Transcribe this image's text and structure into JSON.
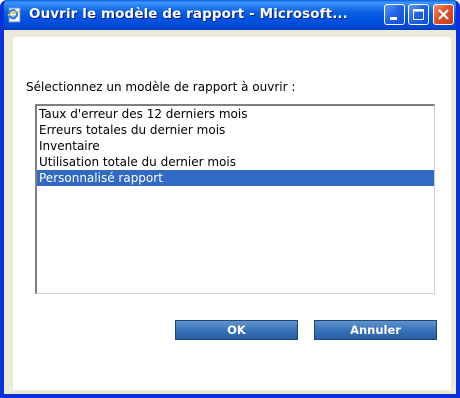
{
  "window": {
    "title": "Ouvrir le modèle de rapport - Microsoft...",
    "app_icon": "ie-document-icon",
    "controls": [
      "minimize-icon",
      "maximize-icon",
      "close-icon"
    ]
  },
  "dialog": {
    "prompt": "Sélectionnez un modèle de rapport à ouvrir :",
    "templates": [
      "Taux d'erreur des 12 derniers mois",
      "Erreurs totales du dernier mois",
      "Inventaire",
      "Utilisation totale du dernier mois",
      "Personnalisé rapport"
    ],
    "selected_index": 4
  },
  "buttons": {
    "ok_label": "OK",
    "cancel_label": "Annuler"
  },
  "colors": {
    "titlebar": "#0054e3",
    "selection": "#316ac5",
    "button": "#3570b8"
  }
}
